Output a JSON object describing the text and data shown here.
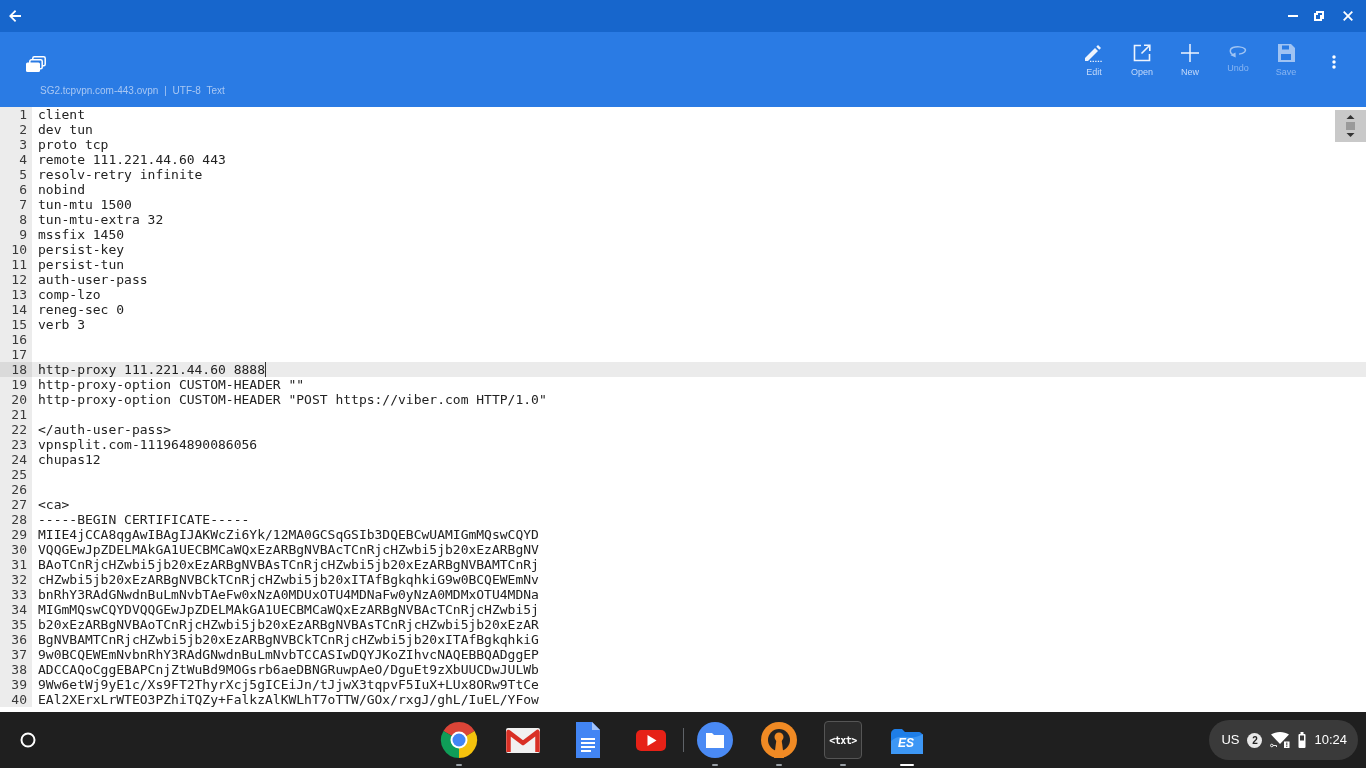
{
  "toolbar": {
    "file_info": "SG2.tcpvpn.com-443.ovpn | UTF-8 Text",
    "actions": [
      {
        "kind": "edit",
        "label": "Edit",
        "disabled": false
      },
      {
        "kind": "open",
        "label": "Open",
        "disabled": false
      },
      {
        "kind": "new",
        "label": "New",
        "disabled": false
      },
      {
        "kind": "undo",
        "label": "Undo",
        "disabled": true
      },
      {
        "kind": "save",
        "label": "Save",
        "disabled": true
      },
      {
        "kind": "more",
        "disabled": false
      }
    ]
  },
  "editor": {
    "lines": [
      {
        "number": "1",
        "text": "client",
        "current": false
      },
      {
        "number": "2",
        "text": "dev tun",
        "current": false
      },
      {
        "number": "3",
        "text": "proto tcp",
        "current": false
      },
      {
        "number": "4",
        "text": "remote 111.221.44.60 443",
        "current": false
      },
      {
        "number": "5",
        "text": "resolv-retry infinite",
        "current": false
      },
      {
        "number": "6",
        "text": "nobind",
        "current": false
      },
      {
        "number": "7",
        "text": "tun-mtu 1500",
        "current": false
      },
      {
        "number": "8",
        "text": "tun-mtu-extra 32",
        "current": false
      },
      {
        "number": "9",
        "text": "mssfix 1450",
        "current": false
      },
      {
        "number": "10",
        "text": "persist-key",
        "current": false
      },
      {
        "number": "11",
        "text": "persist-tun",
        "current": false
      },
      {
        "number": "12",
        "text": "auth-user-pass",
        "current": false
      },
      {
        "number": "13",
        "text": "comp-lzo",
        "current": false
      },
      {
        "number": "14",
        "text": "reneg-sec 0",
        "current": false
      },
      {
        "number": "15",
        "text": "verb 3",
        "current": false
      },
      {
        "number": "16",
        "current": false
      },
      {
        "number": "17",
        "current": false
      },
      {
        "number": "18",
        "text": "http-proxy 111.221.44.60 8888",
        "current": true
      },
      {
        "number": "19",
        "text": "http-proxy-option CUSTOM-HEADER \"\"",
        "current": false
      },
      {
        "number": "20",
        "text": "http-proxy-option CUSTOM-HEADER \"POST https://viber.com HTTP/1.0\"",
        "current": false
      },
      {
        "number": "21",
        "current": false
      },
      {
        "number": "22",
        "text": "</auth-user-pass>",
        "current": false
      },
      {
        "number": "23",
        "text": "vpnsplit.com-111964890086056",
        "current": false
      },
      {
        "number": "24",
        "text": "chupas12",
        "current": false
      },
      {
        "number": "25",
        "current": false
      },
      {
        "number": "26",
        "current": false
      },
      {
        "number": "27",
        "text": "<ca>",
        "current": false
      },
      {
        "number": "28",
        "text": "-----BEGIN CERTIFICATE-----",
        "current": false
      },
      {
        "number": "29",
        "text": "MIIE4jCCA8qgAwIBAgIJAKWcZi6Yk/12MA0GCSqGSIb3DQEBCwUAMIGmMQswCQYD",
        "current": false
      },
      {
        "number": "30",
        "text": "VQQGEwJpZDELMAkGA1UECBMCaWQxEzARBgNVBAcTCnRjcHZwbi5jb20xEzARBgNV",
        "current": false
      },
      {
        "number": "31",
        "text": "BAoTCnRjcHZwbi5jb20xEzARBgNVBAsTCnRjcHZwbi5jb20xEzARBgNVBAMTCnRj",
        "current": false
      },
      {
        "number": "32",
        "text": "cHZwbi5jb20xEzARBgNVBCkTCnRjcHZwbi5jb20xITAfBgkqhkiG9w0BCQEWEmNv",
        "current": false
      },
      {
        "number": "33",
        "text": "bnRhY3RAdGNwdnBuLmNvbTAeFw0xNzA0MDUxOTU4MDNaFw0yNzA0MDMxOTU4MDNa",
        "current": false
      },
      {
        "number": "34",
        "text": "MIGmMQswCQYDVQQGEwJpZDELMAkGA1UECBMCaWQxEzARBgNVBAcTCnRjcHZwbi5j",
        "current": false
      },
      {
        "number": "35",
        "text": "b20xEzARBgNVBAoTCnRjcHZwbi5jb20xEzARBgNVBAsTCnRjcHZwbi5jb20xEzAR",
        "current": false
      },
      {
        "number": "36",
        "text": "BgNVBAMTCnRjcHZwbi5jb20xEzARBgNVBCkTCnRjcHZwbi5jb20xITAfBgkqhkiG",
        "current": false
      },
      {
        "number": "37",
        "text": "9w0BCQEWEmNvbnRhY3RAdGNwdnBuLmNvbTCCASIwDQYJKoZIhvcNAQEBBQADggEP",
        "current": false
      },
      {
        "number": "38",
        "text": "ADCCAQoCggEBAPCnjZtWuBd9MOGsrb6aeDBNGRuwpAeO/DguEt9zXbUUCDwJULWb",
        "current": false
      },
      {
        "number": "39",
        "text": "9Ww6etWj9yE1c/Xs9FT2ThyrXcj5gICEiJn/tJjwX3tqpvF5IuX+LUx8ORw9TtCe",
        "current": false
      },
      {
        "number": "40",
        "text": "EAl2XErxLrWTEO3PZhiTQZy+FalkzAlKWLhT7oTTW/GOx/rxgJ/ghL/IuEL/YFow",
        "current": false
      }
    ]
  },
  "shelf": {
    "apps": [
      {
        "kind": "browser",
        "running": true,
        "active": false,
        "separator_before": false
      },
      {
        "kind": "mail",
        "running": false,
        "active": false,
        "separator_before": false
      },
      {
        "kind": "docs",
        "running": false,
        "active": false,
        "separator_before": false
      },
      {
        "kind": "video",
        "running": false,
        "active": false,
        "separator_before": false
      },
      {
        "kind": "folder",
        "running": true,
        "active": false,
        "separator_before": true
      },
      {
        "kind": "vpn",
        "running": true,
        "active": false,
        "separator_before": false
      },
      {
        "kind": "text",
        "label": "<txt>",
        "running": true,
        "active": false,
        "separator_before": false
      },
      {
        "kind": "files",
        "label": "ES",
        "running": true,
        "active": true,
        "separator_before": false
      }
    ],
    "status": {
      "input_method": "US",
      "notification_count": "2",
      "time": "10:24"
    }
  }
}
